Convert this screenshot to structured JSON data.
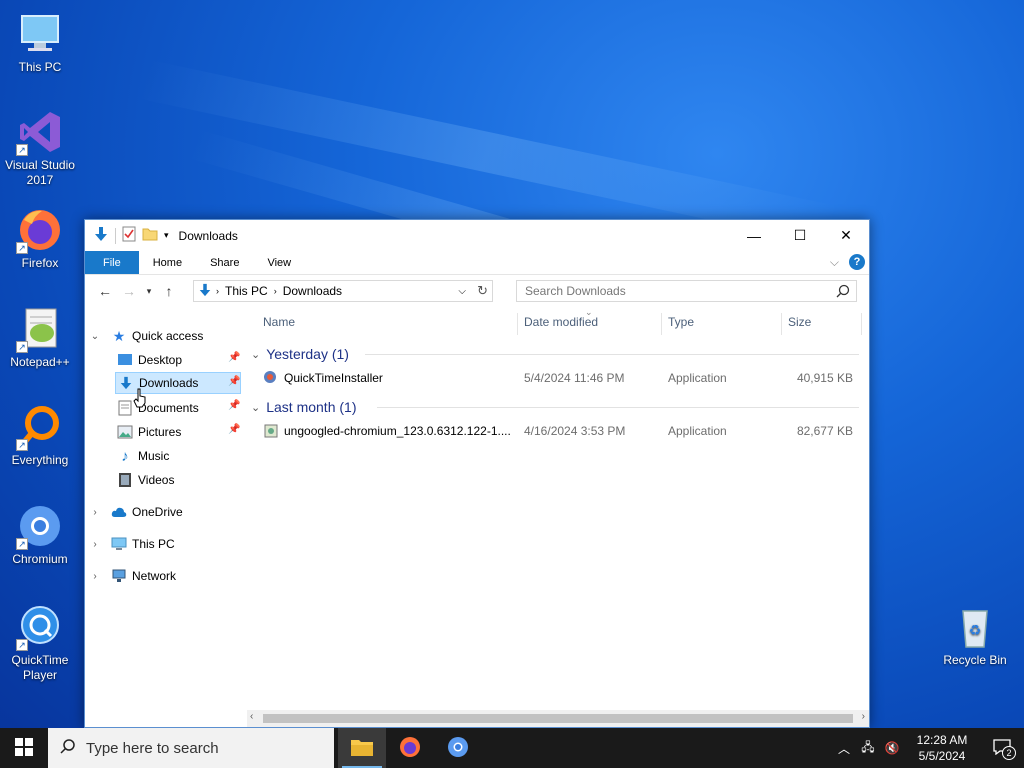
{
  "desktop": {
    "icons": [
      {
        "label": "This PC"
      },
      {
        "label": "Visual Studio 2017"
      },
      {
        "label": "Firefox"
      },
      {
        "label": "Notepad++"
      },
      {
        "label": "Everything"
      },
      {
        "label": "Chromium"
      },
      {
        "label": "QuickTime Player"
      },
      {
        "label": "Recycle Bin"
      }
    ]
  },
  "window": {
    "title": "Downloads",
    "ribbon_tabs": [
      "File",
      "Home",
      "Share",
      "View"
    ],
    "help_glyph": "?",
    "address": {
      "segments": [
        "This PC",
        "Downloads"
      ]
    },
    "search": {
      "placeholder": "Search Downloads"
    },
    "nav": {
      "quick_access": "Quick access",
      "items": [
        "Desktop",
        "Downloads",
        "Documents",
        "Pictures",
        "Music",
        "Videos"
      ],
      "onedrive": "OneDrive",
      "thispc": "This PC",
      "network": "Network"
    },
    "columns": [
      "Name",
      "Date modified",
      "Type",
      "Size"
    ],
    "groups": [
      {
        "label": "Yesterday (1)",
        "files": [
          {
            "name": "QuickTimeInstaller",
            "date": "5/4/2024 11:46 PM",
            "type": "Application",
            "size": "40,915 KB"
          }
        ]
      },
      {
        "label": "Last month (1)",
        "files": [
          {
            "name": "ungoogled-chromium_123.0.6312.122-1....",
            "date": "4/16/2024 3:53 PM",
            "type": "Application",
            "size": "82,677 KB"
          }
        ]
      }
    ]
  },
  "taskbar": {
    "search_placeholder": "Type here to search",
    "time": "12:28 AM",
    "date": "5/5/2024",
    "notification_count": "2"
  },
  "colors": {
    "accent": "#1979ca",
    "selection": "#cce8ff",
    "group_header": "#1e3287"
  }
}
